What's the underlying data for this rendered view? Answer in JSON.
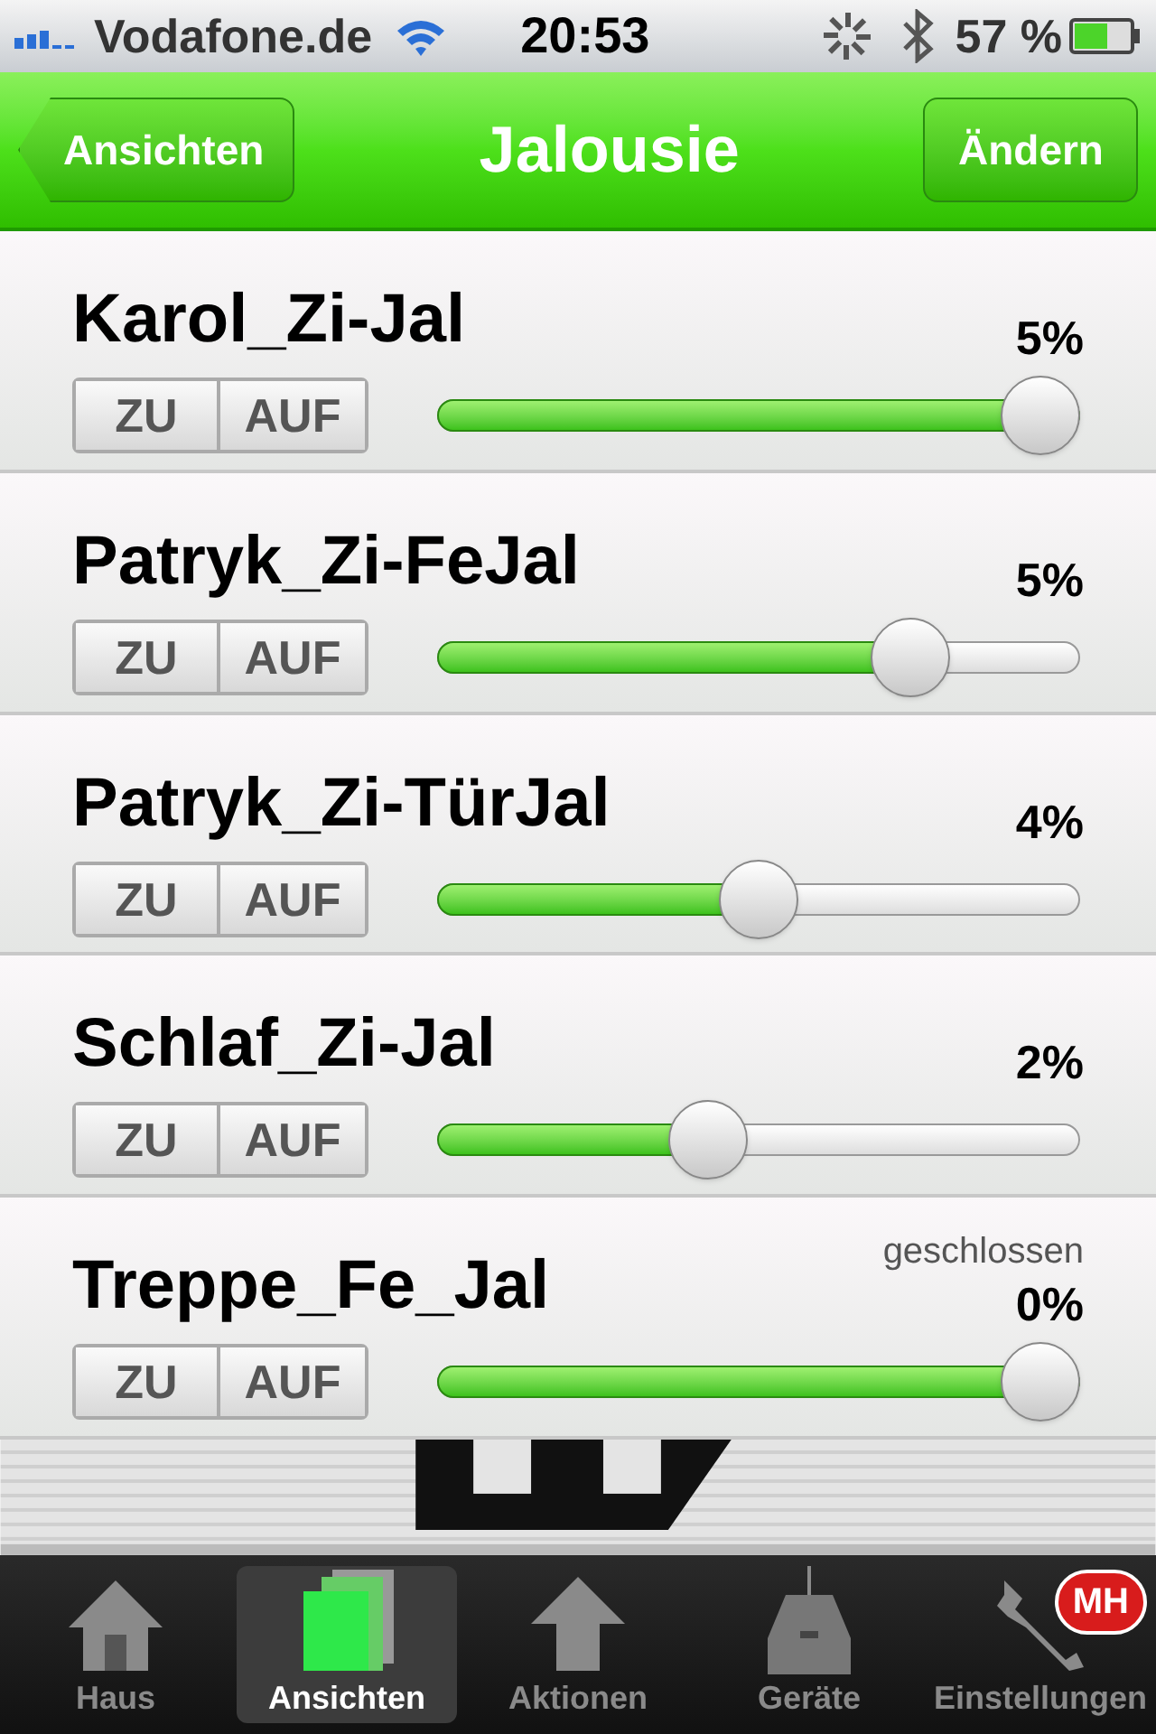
{
  "status_bar": {
    "carrier": "Vodafone.de",
    "time": "20:53",
    "battery": "57 %"
  },
  "nav": {
    "back": "Ansichten",
    "title": "Jalousie",
    "action": "Ändern"
  },
  "blinds": [
    {
      "name": "Karol_Zi-Jal",
      "percent": "5%",
      "close": "ZU",
      "open": "AUF",
      "level": 1.0
    },
    {
      "name": "Patryk_Zi-FeJal",
      "percent": "5%",
      "close": "ZU",
      "open": "AUF",
      "level": 0.77
    },
    {
      "name": "Patryk_Zi-TürJal",
      "percent": "4%",
      "close": "ZU",
      "open": "AUF",
      "level": 0.5
    },
    {
      "name": "Schlaf_Zi-Jal",
      "percent": "2%",
      "close": "ZU",
      "open": "AUF",
      "level": 0.41
    },
    {
      "name": "Treppe_Fe_Jal",
      "status": "geschlossen",
      "percent": "0%",
      "close": "ZU",
      "open": "AUF",
      "level": 1.0
    }
  ],
  "tab_bar": [
    {
      "kind": "house",
      "label": "Haus",
      "selected": false
    },
    {
      "kind": "views",
      "label": "Ansichten",
      "selected": true
    },
    {
      "kind": "arrow",
      "label": "Aktionen",
      "selected": false
    },
    {
      "kind": "device",
      "label": "Geräte",
      "selected": false
    },
    {
      "kind": "wrench",
      "label": "Einstellungen",
      "selected": false,
      "badge": "MH"
    }
  ]
}
